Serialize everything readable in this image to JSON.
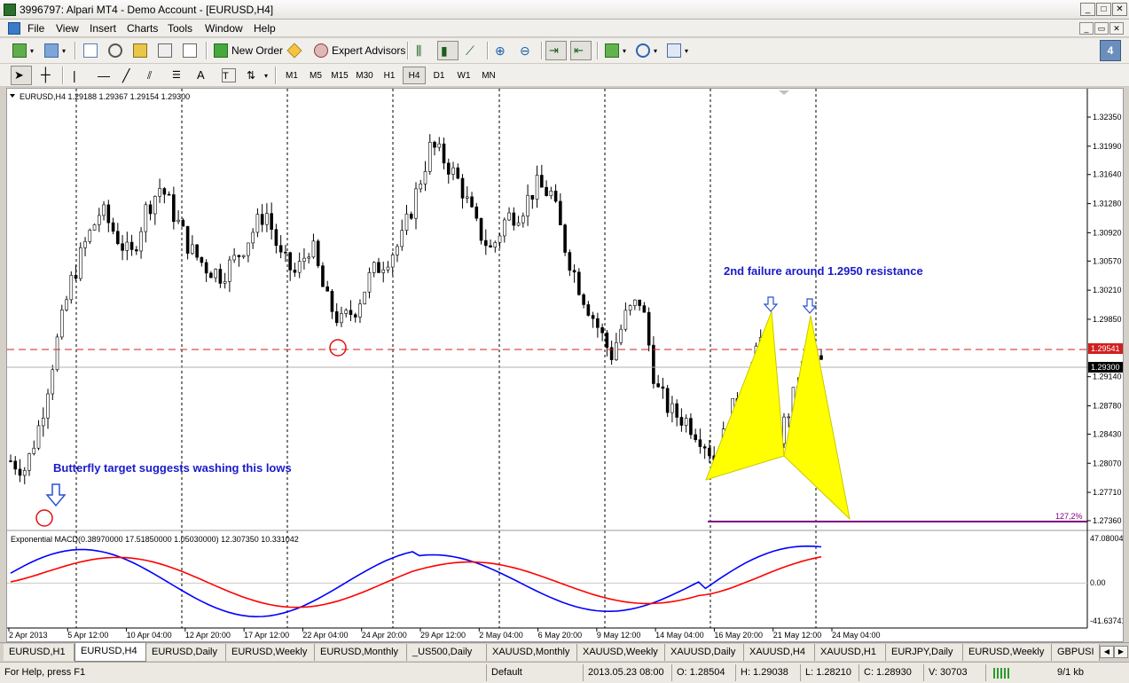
{
  "window": {
    "title": "3996797: Alpari MT4 - Demo Account - [EURUSD,H4]"
  },
  "menu": [
    "File",
    "View",
    "Insert",
    "Charts",
    "Tools",
    "Window",
    "Help"
  ],
  "toolbar": {
    "new_order": "New Order",
    "expert_advisors": "Expert Advisors"
  },
  "timeframes": [
    "M1",
    "M5",
    "M15",
    "M30",
    "H1",
    "H4",
    "D1",
    "W1",
    "MN"
  ],
  "active_timeframe": "H4",
  "chart": {
    "header": "EURUSD,H4  1.29188 1.29367 1.29154 1.29300",
    "price_labels": [
      "1.32350",
      "1.31990",
      "1.31640",
      "1.31280",
      "1.30920",
      "1.30570",
      "1.30210",
      "1.29850",
      "1.29140",
      "1.28780",
      "1.28430",
      "1.28070",
      "1.27710",
      "1.27360"
    ],
    "resistance_label": "1.29541",
    "current_price": "1.29300",
    "fib_label": "127,2%",
    "annotation_top": "2nd failure around 1.2950 resistance",
    "annotation_left": "Butterfly target suggests washing this lows",
    "indicator_header": "Exponential MACD(0.38970000 17.51850000 1.05030000) 12.307350 10.331042",
    "indicator_labels": [
      "47.080047",
      "0.00",
      "-41.63741"
    ],
    "time_labels": [
      "2 Apr 2013",
      "5 Apr 12:00",
      "10 Apr 04:00",
      "12 Apr 20:00",
      "17 Apr 12:00",
      "22 Apr 04:00",
      "24 Apr 20:00",
      "29 Apr 12:00",
      "2 May 04:00",
      "6 May 20:00",
      "9 May 12:00",
      "14 May 04:00",
      "16 May 20:00",
      "21 May 12:00",
      "24 May 04:00"
    ],
    "colors": {
      "candle": "#000000",
      "resistance": "#d02020",
      "pattern": "#ffff00",
      "macd": "#0000ff",
      "signal": "#ff0000",
      "annotation": "#1a1acb",
      "fib": "#800080"
    }
  },
  "chart_data": {
    "type": "candlestick",
    "symbol": "EURUSD",
    "timeframe": "H4",
    "ylim": [
      1.2736,
      1.3235
    ],
    "approx_close_path": [
      1.281,
      1.28,
      1.286,
      1.295,
      1.303,
      1.308,
      1.312,
      1.309,
      1.306,
      1.312,
      1.315,
      1.311,
      1.307,
      1.305,
      1.304,
      1.306,
      1.309,
      1.312,
      1.306,
      1.304,
      1.308,
      1.301,
      1.298,
      1.3,
      1.304,
      1.306,
      1.308,
      1.314,
      1.32,
      1.318,
      1.315,
      1.31,
      1.307,
      1.311,
      1.312,
      1.315,
      1.314,
      1.307,
      1.302,
      1.298,
      1.294,
      1.299,
      1.301,
      1.29,
      1.287,
      1.286,
      1.284,
      1.281,
      1.287,
      1.29,
      1.296,
      1.283,
      1.288,
      1.294,
      1.293
    ]
  },
  "tabs": [
    "EURUSD,H1",
    "EURUSD,H4",
    "EURUSD,Daily",
    "EURUSD,Weekly",
    "EURUSD,Monthly",
    "_US500,Daily",
    "XAUUSD,Monthly",
    "XAUUSD,Weekly",
    "XAUUSD,Daily",
    "XAUUSD,H4",
    "XAUUSD,H1",
    "EURJPY,Daily",
    "EURUSD,Weekly",
    "GBPUSI"
  ],
  "active_tab": "EURUSD,H4",
  "status": {
    "help": "For Help, press F1",
    "profile": "Default",
    "time": "2013.05.23 08:00",
    "open": "O: 1.28504",
    "high": "H: 1.29038",
    "low": "L: 1.28210",
    "close": "C: 1.28930",
    "volume": "V: 30703",
    "traffic": "9/1 kb"
  }
}
